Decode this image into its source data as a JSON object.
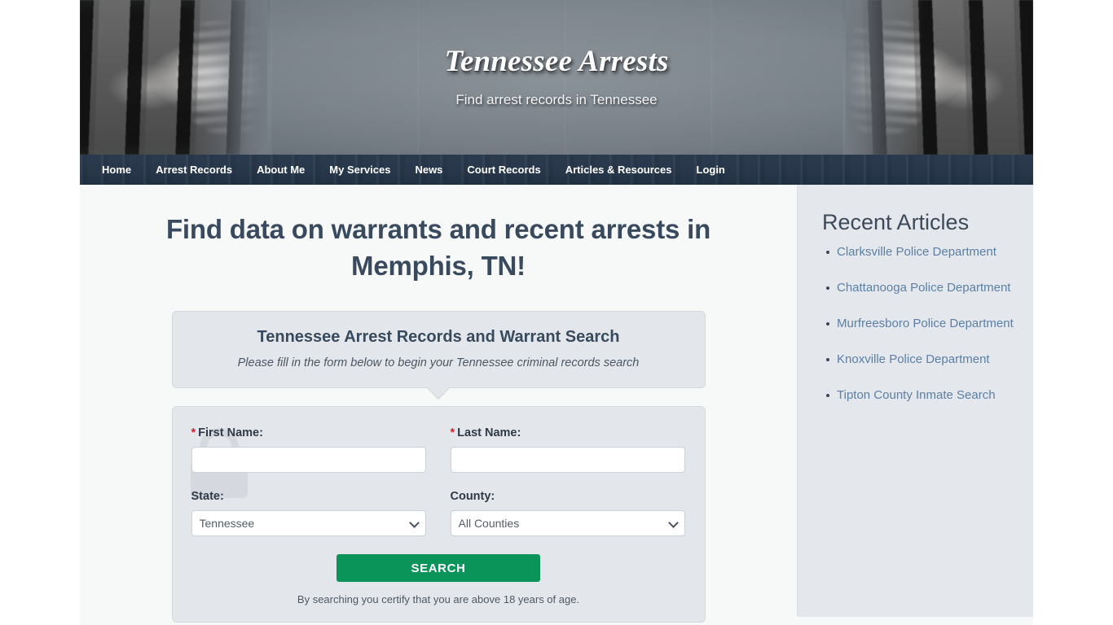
{
  "masthead": {
    "title": "Tennessee Arrests",
    "tagline": "Find arrest records in Tennessee",
    "left_photo_alt": "jail-bars-hands",
    "right_photo_alt": "jail-bars-hands"
  },
  "nav": {
    "items": [
      {
        "label": "Home"
      },
      {
        "label": "Arrest Records"
      },
      {
        "label": "About Me"
      },
      {
        "label": "My Services"
      },
      {
        "label": "News"
      },
      {
        "label": "Court Records"
      },
      {
        "label": "Articles & Resources"
      },
      {
        "label": "Login"
      }
    ]
  },
  "main": {
    "page_heading": "Find data on warrants and recent arrests in Memphis, TN!",
    "callout": {
      "title": "Tennessee Arrest Records and Warrant Search",
      "subtitle": "Please fill in the form below to begin your Tennessee criminal records search"
    },
    "form": {
      "required_marker": "*",
      "first_name": {
        "label": "First Name:",
        "value": "",
        "placeholder": ""
      },
      "last_name": {
        "label": "Last Name:",
        "value": "",
        "placeholder": ""
      },
      "state": {
        "label": "State:",
        "value": "Tennessee",
        "options": [
          "Tennessee"
        ]
      },
      "county": {
        "label": "County:",
        "value": "All Counties",
        "options": [
          "All Counties"
        ]
      },
      "submit_label": "SEARCH",
      "disclaimer": "By searching you certify that you are above 18 years of age."
    }
  },
  "sidebar": {
    "title": "Recent Articles",
    "articles": [
      {
        "label": "Clarksville Police Department"
      },
      {
        "label": "Chattanooga Police Department"
      },
      {
        "label": "Murfreesboro Police Department"
      },
      {
        "label": "Knoxville Police Department"
      },
      {
        "label": "Tipton County Inmate Search"
      }
    ]
  },
  "colors": {
    "nav_background": "#28374a",
    "heading_text": "#3a4a5e",
    "button_green": "#0a9459",
    "link_blue": "#5b7fa6",
    "required_red": "#e01b2e",
    "panel_gray": "#e3e7eb",
    "sidebar_background": "#e4e8ec"
  }
}
